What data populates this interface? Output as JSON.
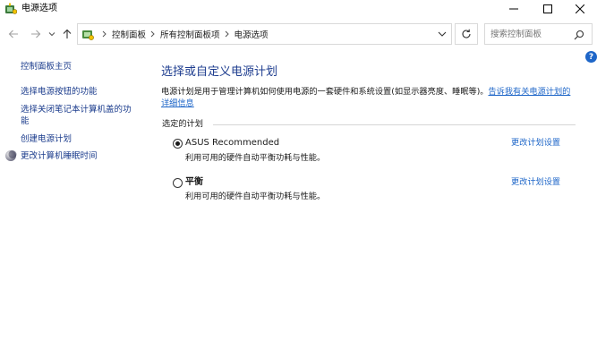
{
  "window": {
    "title": "电源选项",
    "app_icon": "power-options-icon",
    "controls": {
      "minimize": "minimize-icon",
      "maximize": "maximize-icon",
      "close": "close-icon"
    }
  },
  "address_bar": {
    "breadcrumbs": [
      "控制面板",
      "所有控制面板项",
      "电源选项"
    ],
    "icon": "control-panel-icon"
  },
  "search": {
    "placeholder": "搜索控制面板"
  },
  "left_nav": {
    "home": "控制面板主页",
    "links": [
      "选择电源按钮的功能",
      "选择关闭笔记本计算机盖的功能",
      "创建电源计划",
      "更改计算机睡眠时间"
    ]
  },
  "main": {
    "title": "选择或自定义电源计划",
    "description": "电源计划是用于管理计算机如何使用电源的一套硬件和系统设置(如显示器亮度、睡眠等)。",
    "description_link": "告诉我有关电源计划的详细信息",
    "section_label": "选定的计划",
    "plans": [
      {
        "name": "ASUS Recommended",
        "description": "利用可用的硬件自动平衡功耗与性能。",
        "link": "更改计划设置",
        "selected": true
      },
      {
        "name": "平衡",
        "description": "利用可用的硬件自动平衡功耗与性能。",
        "link": "更改计划设置",
        "selected": false
      }
    ],
    "help": "?"
  },
  "colors": {
    "link": "#1e66c8",
    "heading": "#1e3d8f",
    "nav_link": "#1a3b8c"
  }
}
